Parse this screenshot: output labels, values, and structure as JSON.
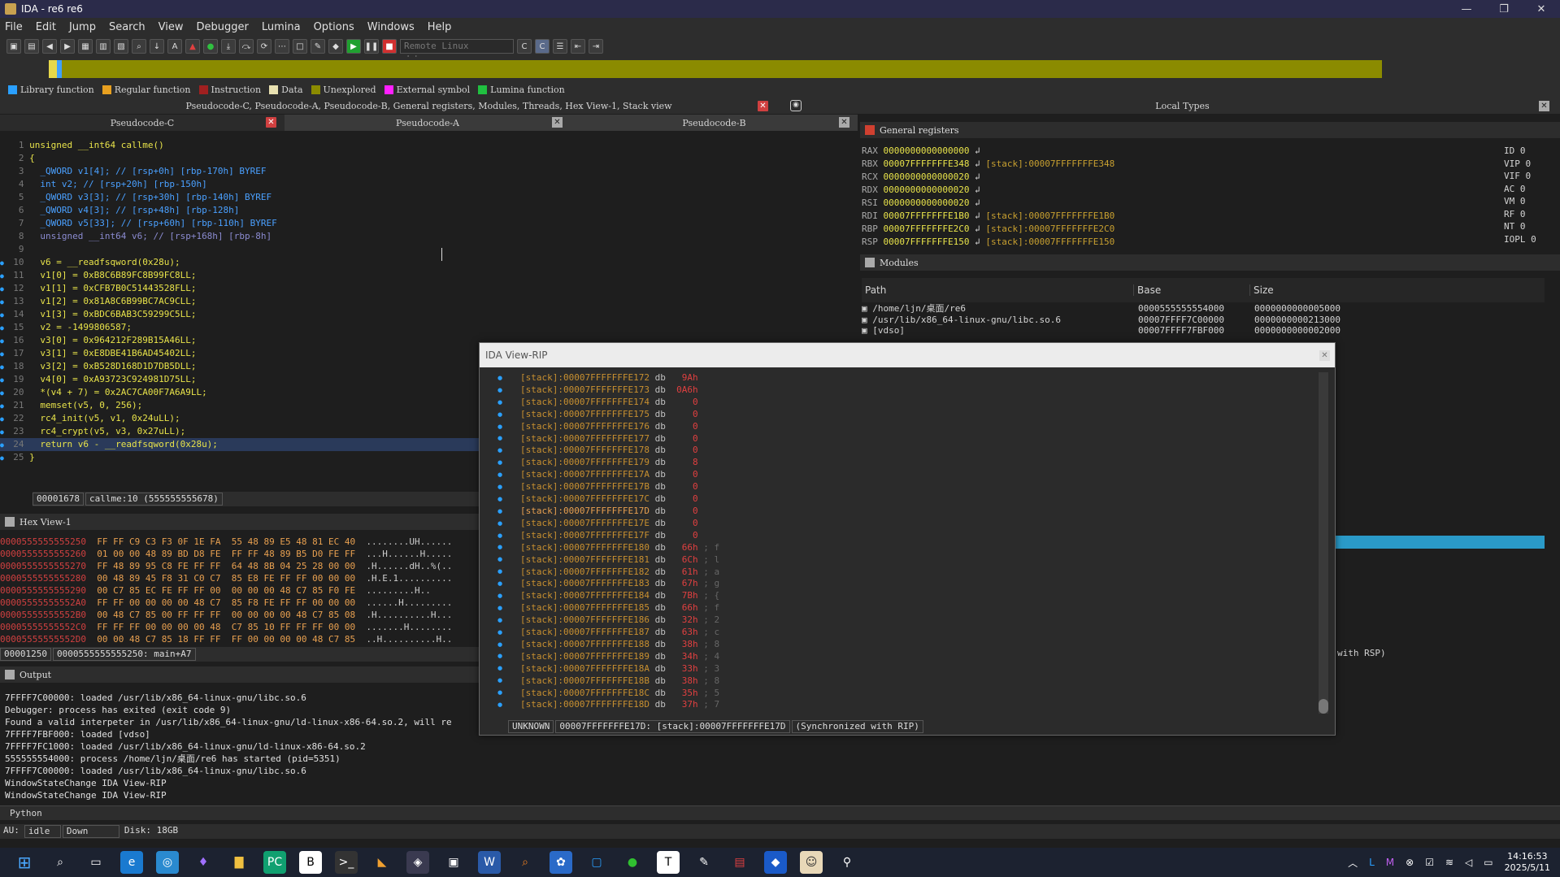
{
  "window": {
    "title": "IDA - re6 re6",
    "min": "—",
    "max": "❐",
    "close": "✕"
  },
  "menu": [
    "File",
    "Edit",
    "Jump",
    "Search",
    "View",
    "Debugger",
    "Lumina",
    "Options",
    "Windows",
    "Help"
  ],
  "toolbar": {
    "debugger_select": "Remote Linux debugger"
  },
  "legend": [
    {
      "label": "Library function",
      "color": "#2aa0ff"
    },
    {
      "label": "Regular function",
      "color": "#e8a020"
    },
    {
      "label": "Instruction",
      "color": "#a02020"
    },
    {
      "label": "Data",
      "color": "#e8e0b0"
    },
    {
      "label": "Unexplored",
      "color": "#8b8b00"
    },
    {
      "label": "External symbol",
      "color": "#ff20ff"
    },
    {
      "label": "Lumina function",
      "color": "#20c040"
    }
  ],
  "dock": {
    "top_title": "Pseudocode-C, Pseudocode-A, Pseudocode-B, General registers, Modules, Threads, Hex View-1, Stack view",
    "local_types": "Local Types",
    "tabs": [
      "Pseudocode-C",
      "Pseudocode-A",
      "Pseudocode-B"
    ]
  },
  "pseudocode": {
    "lines": [
      {
        "n": "1",
        "t": "unsigned __int64 callme()"
      },
      {
        "n": "2",
        "t": "{"
      },
      {
        "n": "3",
        "t": "  _QWORD v1[4]; // [rsp+0h] [rbp-170h] BYREF"
      },
      {
        "n": "4",
        "t": "  int v2; // [rsp+20h] [rbp-150h]"
      },
      {
        "n": "5",
        "t": "  _QWORD v3[3]; // [rsp+30h] [rbp-140h] BYREF"
      },
      {
        "n": "6",
        "t": "  _QWORD v4[3]; // [rsp+48h] [rbp-128h]"
      },
      {
        "n": "7",
        "t": "  _QWORD v5[33]; // [rsp+60h] [rbp-110h] BYREF"
      },
      {
        "n": "8",
        "t": "  unsigned __int64 v6; // [rsp+168h] [rbp-8h]"
      },
      {
        "n": "9",
        "t": ""
      },
      {
        "n": "10",
        "t": "  v6 = __readfsqword(0x28u);"
      },
      {
        "n": "11",
        "t": "  v1[0] = 0xB8C6B89FC8B99FC8LL;"
      },
      {
        "n": "12",
        "t": "  v1[1] = 0xCFB7B0C51443528FLL;"
      },
      {
        "n": "13",
        "t": "  v1[2] = 0x81A8C6B99BC7AC9CLL;"
      },
      {
        "n": "14",
        "t": "  v1[3] = 0xBDC6BAB3C59299C5LL;"
      },
      {
        "n": "15",
        "t": "  v2 = -1499806587;"
      },
      {
        "n": "16",
        "t": "  v3[0] = 0x964212F289B15A46LL;"
      },
      {
        "n": "17",
        "t": "  v3[1] = 0xE8DBE41B6AD45402LL;"
      },
      {
        "n": "18",
        "t": "  v3[2] = 0xB528D168D1D7DB5DLL;"
      },
      {
        "n": "19",
        "t": "  v4[0] = 0xA93723C924981D75LL;"
      },
      {
        "n": "20",
        "t": "  *(v4 + 7) = 0x2AC7CA00F7A6A9LL;"
      },
      {
        "n": "21",
        "t": "  memset(v5, 0, 256);"
      },
      {
        "n": "22",
        "t": "  rc4_init(v5, v1, 0x24uLL);"
      },
      {
        "n": "23",
        "t": "  rc4_crypt(v5, v3, 0x27uLL);"
      },
      {
        "n": "24",
        "t": "  return v6 - __readfsqword(0x28u);"
      },
      {
        "n": "25",
        "t": "}"
      }
    ],
    "status_addr": "00001678",
    "status_loc": "callme:10 (555555555678)"
  },
  "registers": {
    "title": "General registers",
    "rows": [
      {
        "reg": "RAX",
        "val": "0000000000000000",
        "ref": ""
      },
      {
        "reg": "RBX",
        "val": "00007FFFFFFFE348",
        "ref": "[stack]:00007FFFFFFFE348"
      },
      {
        "reg": "RCX",
        "val": "0000000000000020",
        "ref": ""
      },
      {
        "reg": "RDX",
        "val": "0000000000000020",
        "ref": ""
      },
      {
        "reg": "RSI",
        "val": "0000000000000020",
        "ref": ""
      },
      {
        "reg": "RDI",
        "val": "00007FFFFFFFE1B0",
        "ref": "[stack]:00007FFFFFFFE1B0"
      },
      {
        "reg": "RBP",
        "val": "00007FFFFFFFE2C0",
        "ref": "[stack]:00007FFFFFFFE2C0"
      },
      {
        "reg": "RSP",
        "val": "00007FFFFFFFE150",
        "ref": "[stack]:00007FFFFFFFE150"
      }
    ],
    "flags": [
      {
        "f": "ID",
        "v": "0"
      },
      {
        "f": "VIP",
        "v": "0"
      },
      {
        "f": "VIF",
        "v": "0"
      },
      {
        "f": "AC",
        "v": "0"
      },
      {
        "f": "VM",
        "v": "0"
      },
      {
        "f": "RF",
        "v": "0"
      },
      {
        "f": "NT",
        "v": "0"
      },
      {
        "f": "IOPL",
        "v": "0"
      }
    ]
  },
  "modules": {
    "title": "Modules",
    "headers": [
      "Path",
      "Base",
      "Size"
    ],
    "rows": [
      {
        "path": "/home/ljn/桌面/re6",
        "base": "0000555555554000",
        "size": "0000000000005000"
      },
      {
        "path": "/usr/lib/x86_64-linux-gnu/libc.so.6",
        "base": "00007FFFF7C00000",
        "size": "0000000000213000"
      },
      {
        "path": "[vdso]",
        "base": "00007FFFF7FBF000",
        "size": "0000000000002000"
      }
    ]
  },
  "hexview": {
    "title": "Hex View-1",
    "rows": [
      {
        "addr": "0000555555555250",
        "bytes": "FF FF C9 C3 F3 0F 1E FA  55 48 89 E5 48 81 EC 40",
        "asc": "........UH......"
      },
      {
        "addr": "0000555555555260",
        "bytes": "01 00 00 48 89 BD D8 FE  FF FF 48 89 B5 D0 FE FF",
        "asc": "...H......H....."
      },
      {
        "addr": "0000555555555270",
        "bytes": "FF 48 89 95 C8 FE FF FF  64 48 8B 04 25 28 00 00",
        "asc": ".H......dH..%(.."
      },
      {
        "addr": "0000555555555280",
        "bytes": "00 48 89 45 F8 31 C0 C7  85 E8 FE FF FF 00 00 00",
        "asc": ".H.E.1.........."
      },
      {
        "addr": "0000555555555290",
        "bytes": "00 C7 85 EC FE FF FF 00  00 00 00 48 C7 85 F0 FE",
        "asc": ".........H.."
      },
      {
        "addr": "00005555555552A0",
        "bytes": "FF FF 00 00 00 00 48 C7  85 F8 FE FF FF 00 00 00",
        "asc": "......H........."
      },
      {
        "addr": "00005555555552B0",
        "bytes": "00 48 C7 85 00 FF FF FF  00 00 00 00 48 C7 85 08",
        "asc": ".H..........H..."
      },
      {
        "addr": "00005555555552C0",
        "bytes": "FF FF FF 00 00 00 00 48  C7 85 10 FF FF FF 00 00",
        "asc": ".......H........"
      },
      {
        "addr": "00005555555552D0",
        "bytes": "00 00 48 C7 85 18 FF FF  FF 00 00 00 00 48 C7 85",
        "asc": "..H..........H.."
      }
    ],
    "status_off": "00001250",
    "status_loc": "0000555555555250: main+A7"
  },
  "output": {
    "title": "Output",
    "lines": [
      "7FFFF7C00000: loaded /usr/lib/x86_64-linux-gnu/libc.so.6",
      "Debugger: process has exited (exit code 9)",
      "Found a valid interpeter in /usr/lib/x86_64-linux-gnu/ld-linux-x86-64.so.2, will re",
      "7FFFF7FBF000: loaded [vdso]",
      "7FFFF7FC1000: loaded /usr/lib/x86_64-linux-gnu/ld-linux-x86-64.so.2",
      "555555554000: process /home/ljn/桌面/re6 has started (pid=5351)",
      "7FFFF7C00000: loaded /usr/lib/x86_64-linux-gnu/libc.so.6",
      "WindowStateChange IDA View-RIP",
      "WindowStateChange IDA View-RIP"
    ],
    "python": "Python"
  },
  "bottomstatus": {
    "au": "AU:",
    "state": "idle",
    "dir": "Down",
    "disk": "Disk: 18GB"
  },
  "idaview": {
    "title": "IDA View-RIP",
    "rows": [
      {
        "a": "[stack]:00007FFFFFFFE172",
        "v": "9Ah",
        "c": ""
      },
      {
        "a": "[stack]:00007FFFFFFFE173",
        "v": "0A6h",
        "c": ""
      },
      {
        "a": "[stack]:00007FFFFFFFE174",
        "v": "0",
        "c": ""
      },
      {
        "a": "[stack]:00007FFFFFFFE175",
        "v": "0",
        "c": ""
      },
      {
        "a": "[stack]:00007FFFFFFFE176",
        "v": "0",
        "c": ""
      },
      {
        "a": "[stack]:00007FFFFFFFE177",
        "v": "0",
        "c": ""
      },
      {
        "a": "[stack]:00007FFFFFFFE178",
        "v": "0",
        "c": ""
      },
      {
        "a": "[stack]:00007FFFFFFFE179",
        "v": "8",
        "c": ""
      },
      {
        "a": "[stack]:00007FFFFFFFE17A",
        "v": "0",
        "c": ""
      },
      {
        "a": "[stack]:00007FFFFFFFE17B",
        "v": "0",
        "c": ""
      },
      {
        "a": "[stack]:00007FFFFFFFE17C",
        "v": "0",
        "c": ""
      },
      {
        "a": "[stack]:00007FFFFFFFE17D",
        "v": "0",
        "c": ""
      },
      {
        "a": "[stack]:00007FFFFFFFE17E",
        "v": "0",
        "c": ""
      },
      {
        "a": "[stack]:00007FFFFFFFE17F",
        "v": "0",
        "c": ""
      },
      {
        "a": "[stack]:00007FFFFFFFE180",
        "v": "66h",
        "c": "; f"
      },
      {
        "a": "[stack]:00007FFFFFFFE181",
        "v": "6Ch",
        "c": "; l"
      },
      {
        "a": "[stack]:00007FFFFFFFE182",
        "v": "61h",
        "c": "; a"
      },
      {
        "a": "[stack]:00007FFFFFFFE183",
        "v": "67h",
        "c": "; g"
      },
      {
        "a": "[stack]:00007FFFFFFFE184",
        "v": "7Bh",
        "c": "; {"
      },
      {
        "a": "[stack]:00007FFFFFFFE185",
        "v": "66h",
        "c": "; f"
      },
      {
        "a": "[stack]:00007FFFFFFFE186",
        "v": "32h",
        "c": "; 2"
      },
      {
        "a": "[stack]:00007FFFFFFFE187",
        "v": "63h",
        "c": "; c"
      },
      {
        "a": "[stack]:00007FFFFFFFE188",
        "v": "38h",
        "c": "; 8"
      },
      {
        "a": "[stack]:00007FFFFFFFE189",
        "v": "34h",
        "c": "; 4"
      },
      {
        "a": "[stack]:00007FFFFFFFE18A",
        "v": "33h",
        "c": "; 3"
      },
      {
        "a": "[stack]:00007FFFFFFFE18B",
        "v": "38h",
        "c": "; 8"
      },
      {
        "a": "[stack]:00007FFFFFFFE18C",
        "v": "35h",
        "c": "; 5"
      },
      {
        "a": "[stack]:00007FFFFFFFE18D",
        "v": "37h",
        "c": "; 7"
      }
    ],
    "db": "db",
    "status_unknown": "UNKNOWN",
    "status_loc": "00007FFFFFFFE17D: [stack]:00007FFFFFFFE17D",
    "status_sync": "(Synchronized with RIP)"
  },
  "taskbar": {
    "time": "14:16:53",
    "date": "2025/5/11"
  },
  "misc": {
    "with_rsp": "with RSP)"
  }
}
